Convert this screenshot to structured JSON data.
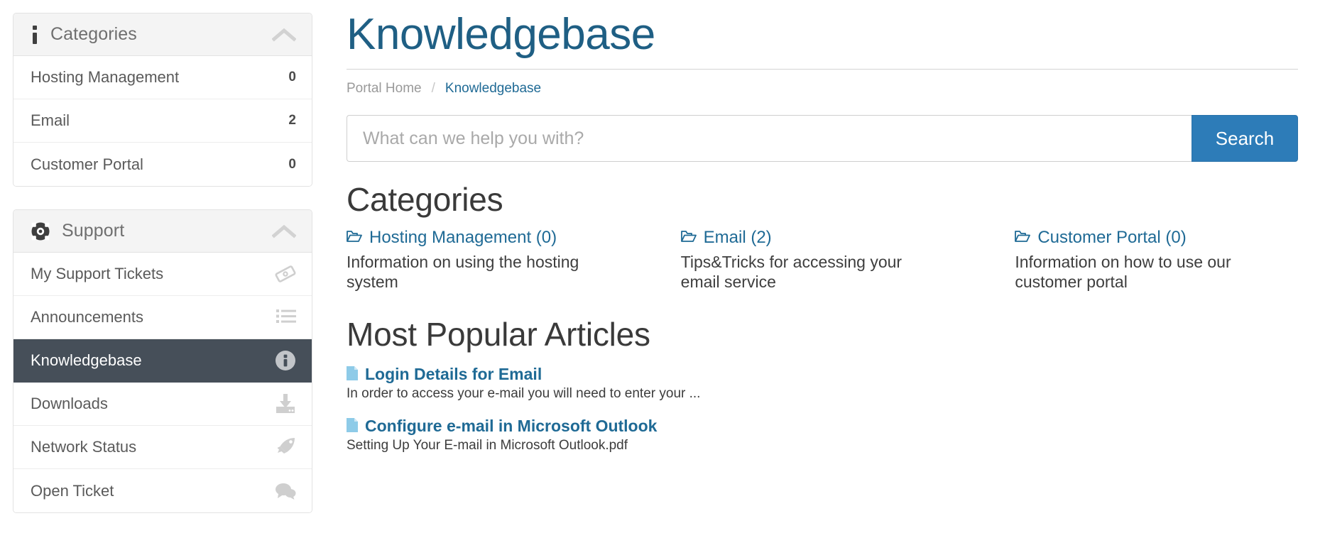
{
  "sidebar": {
    "categories_panel": {
      "title": "Categories",
      "icon": "info-icon",
      "collapse_icon": "chevron-up-icon",
      "items": [
        {
          "label": "Hosting Management",
          "count": "0"
        },
        {
          "label": "Email",
          "count": "2"
        },
        {
          "label": "Customer Portal",
          "count": "0"
        }
      ]
    },
    "support_panel": {
      "title": "Support",
      "icon": "lifebuoy-icon",
      "collapse_icon": "chevron-up-icon",
      "items": [
        {
          "label": "My Support Tickets",
          "icon": "ticket-icon",
          "active": false
        },
        {
          "label": "Announcements",
          "icon": "list-icon",
          "active": false
        },
        {
          "label": "Knowledgebase",
          "icon": "info-circle-icon",
          "active": true
        },
        {
          "label": "Downloads",
          "icon": "download-icon",
          "active": false
        },
        {
          "label": "Network Status",
          "icon": "rocket-icon",
          "active": false
        },
        {
          "label": "Open Ticket",
          "icon": "comments-icon",
          "active": false
        }
      ]
    }
  },
  "main": {
    "page_title": "Knowledgebase",
    "breadcrumb": {
      "home": "Portal Home",
      "separator": "/",
      "current": "Knowledgebase"
    },
    "search": {
      "placeholder": "What can we help you with?",
      "value": "",
      "button_label": "Search"
    },
    "categories_heading": "Categories",
    "categories": [
      {
        "title": "Hosting Management (0)",
        "description": "Information on using the hosting system",
        "icon": "folder-open-icon"
      },
      {
        "title": "Email (2)",
        "description": "Tips&Tricks for accessing your email service",
        "icon": "folder-open-icon"
      },
      {
        "title": "Customer Portal (0)",
        "description": "Information on how to use our customer portal",
        "icon": "folder-open-icon"
      }
    ],
    "popular_heading": "Most Popular Articles",
    "articles": [
      {
        "title": "Login Details for Email",
        "snippet": "In order to access your e-mail you will need to enter your ...",
        "icon": "file-icon"
      },
      {
        "title": "Configure e-mail in Microsoft Outlook",
        "snippet": "Setting Up Your E-mail in Microsoft Outlook.pdf",
        "icon": "file-icon"
      }
    ]
  },
  "colors": {
    "title_blue": "#1f5f84",
    "link_blue": "#1f6a95",
    "button_blue": "#2d7cb8",
    "active_row": "#464f59",
    "panel_head": "#f4f4f4",
    "file_icon_blue": "#8ecbe8"
  }
}
